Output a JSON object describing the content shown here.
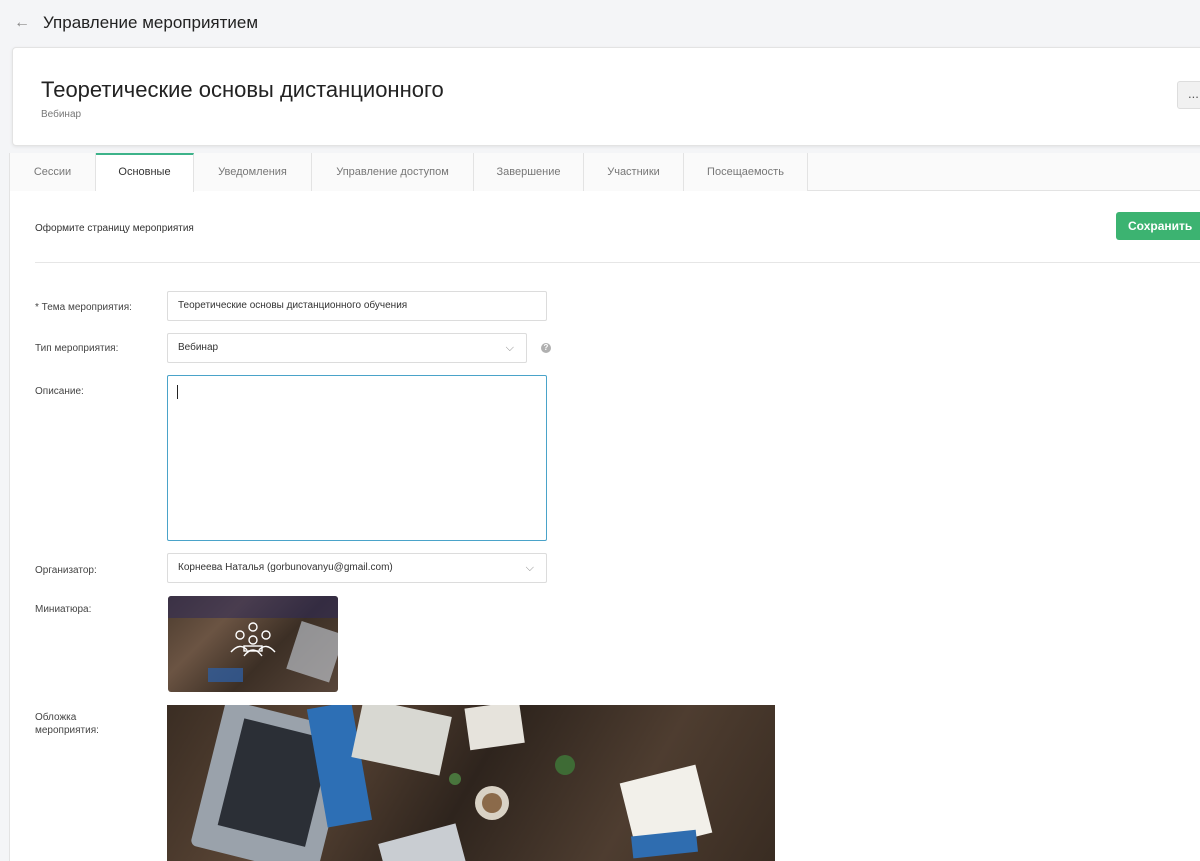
{
  "topbar": {
    "title": "Управление мероприятием"
  },
  "header": {
    "title": "Теоретические основы дистанционного",
    "type": "Вебинар",
    "more_label": "..."
  },
  "tabs": [
    {
      "label": "Сессии",
      "active": false
    },
    {
      "label": "Основные",
      "active": true
    },
    {
      "label": "Уведомления",
      "active": false
    },
    {
      "label": "Управление доступом",
      "active": false
    },
    {
      "label": "Завершение",
      "active": false
    },
    {
      "label": "Участники",
      "active": false
    },
    {
      "label": "Посещаемость",
      "active": false
    }
  ],
  "section": {
    "title": "Оформите страницу мероприятия",
    "save_label": "Сохранить"
  },
  "form": {
    "topic_label": "* Тема мероприятия:",
    "topic_value": "Теоретические основы дистанционного обучения",
    "type_label": "Тип мероприятия:",
    "type_value": "Вебинар",
    "description_label": "Описание:",
    "description_value": "",
    "organizer_label": "Организатор:",
    "organizer_value": "Корнеева Наталья (gorbunovanyu@gmail.com)",
    "thumbnail_label": "Миниатюра:",
    "cover_label_1": "Обложка",
    "cover_label_2": "мероприятия:"
  },
  "colors": {
    "accent": "#3cb371",
    "active_tab": "#3db38a",
    "focus_border": "#4aa3c9"
  },
  "icons": {
    "back": "arrow-left-icon",
    "more": "more-icon",
    "dropdown": "chevron-down-icon",
    "help": "help-icon",
    "meeting": "meeting-people-icon"
  }
}
